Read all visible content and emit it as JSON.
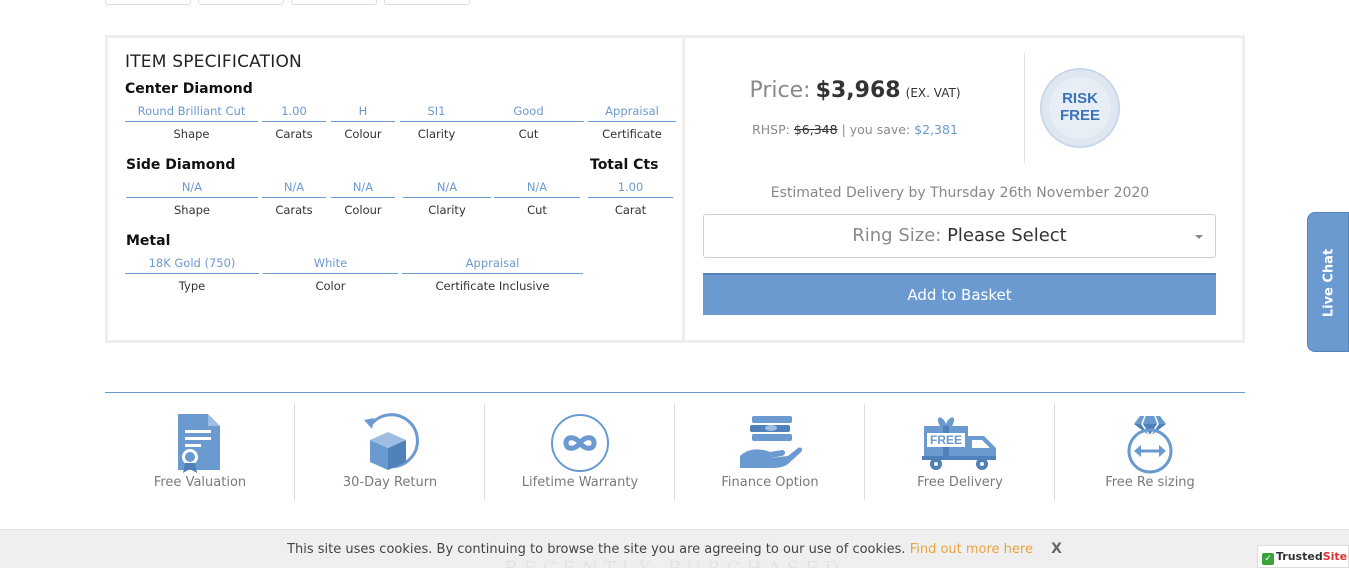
{
  "spec": {
    "title": "ITEM SPECIFICATION",
    "center_heading": "Center Diamond",
    "center": [
      {
        "value": "Round Brilliant Cut",
        "label": "Shape"
      },
      {
        "value": "1.00",
        "label": "Carats"
      },
      {
        "value": "H",
        "label": "Colour"
      },
      {
        "value": "SI1",
        "label": "Clarity"
      },
      {
        "value": "Good",
        "label": "Cut"
      },
      {
        "value": "Appraisal",
        "label": "Certificate"
      }
    ],
    "side_heading": "Side Diamond",
    "total_heading": "Total Cts",
    "side": [
      {
        "value": "N/A",
        "label": "Shape"
      },
      {
        "value": "N/A",
        "label": "Carats"
      },
      {
        "value": "N/A",
        "label": "Colour"
      },
      {
        "value": "N/A",
        "label": "Clarity"
      },
      {
        "value": "N/A",
        "label": "Cut"
      },
      {
        "value": "1.00",
        "label": "Carat"
      }
    ],
    "metal_heading": "Metal",
    "metal": [
      {
        "value": "18K Gold (750)",
        "label": "Type"
      },
      {
        "value": "White",
        "label": "Color"
      },
      {
        "value": "Appraisal",
        "label": "Certificate Inclusive"
      }
    ]
  },
  "purchase": {
    "price_label": "Price:",
    "price": "$3,968",
    "vat": "(EX. VAT)",
    "rhsp_label": "RHSP:",
    "rhsp_value": "$6,348",
    "separator": "|",
    "save_label": "you save:",
    "save_value": "$2,381",
    "badge_line1": "RISK",
    "badge_line2": "FREE",
    "delivery": "Estimated Delivery by Thursday 26th November 2020",
    "ring_label": "Ring Size:",
    "ring_value": "Please Select",
    "basket_button": "Add to Basket"
  },
  "features": [
    {
      "label": "Free Valuation",
      "icon": "certificate-icon"
    },
    {
      "label": "30-Day Return",
      "icon": "box-return-icon"
    },
    {
      "label": "Lifetime Warranty",
      "icon": "infinity-icon"
    },
    {
      "label": "Finance Option",
      "icon": "money-hand-icon"
    },
    {
      "label": "Free Delivery",
      "icon": "delivery-truck-icon"
    },
    {
      "label": "Free Re sizing",
      "icon": "ring-resize-icon"
    }
  ],
  "live_chat": "Live Chat",
  "cookie": {
    "text": "This site uses cookies. By continuing to browse the site you are agreeing to our use of cookies.",
    "link": "Find out more here",
    "close": "X",
    "background_heading": "RECENTLY PURCHASED"
  },
  "trusted": {
    "check": "✓",
    "name": "Trusted",
    "suffix": "Site"
  },
  "colors": {
    "accent": "#6a9ad0",
    "link_orange": "#e8a33d"
  }
}
